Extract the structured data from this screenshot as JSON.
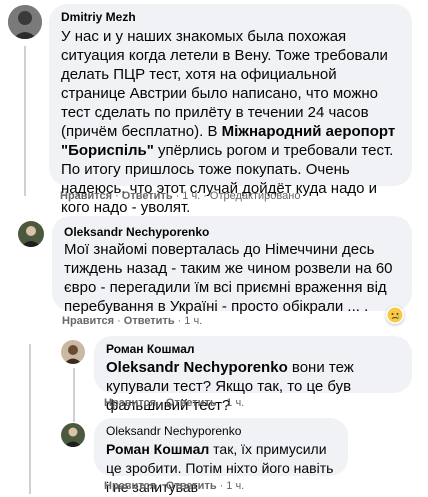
{
  "actions": {
    "like": "Нравится",
    "reply": "Ответить",
    "dot": "·"
  },
  "comments": [
    {
      "author": "Dmitriy Mezh",
      "text_parts": [
        "У нас и у наших знакомых была похожая ситуация когда летели в Вену. Тоже требовали делать ПЦР тест, хотя на официальной странице Австрии было написано, что можно тест сделать по прилёту в течении 24 часов (причём бесплатно). В ",
        "Міжнародний аеропорт \"Бориспіль\"",
        " упёрлись рогом и требовали тест. По итогу пришлось тоже покупать. Очень надеюсь, что этот случай дойдёт куда надо и кого надо - уволят."
      ],
      "time": "1 ч.",
      "edited": "Отредактировано"
    },
    {
      "author": "Oleksandr Nechyporenko",
      "text": "Мої знайомі поверталась до Німеччини десь тиждень назад - таким же чином розвели на 60 євро - перегадили їм всі приємні враження від перебування в Україні - просто обікрали ... .",
      "time": "1 ч.",
      "reaction": "sad-reaction"
    },
    {
      "author": "Роман Кошмал",
      "mention": "Oleksandr Nechyporenko",
      "text": " вони теж купували тест? Якщо так, то це був фальшивий тест?",
      "time": "1 ч."
    },
    {
      "author": "Oleksandr Nechyporenko",
      "mention": "Роман Кошмал",
      "text": " так, їх примусили це зробити. Потім ніхто його навіть і не запитував",
      "time": "1 ч."
    }
  ],
  "colors": {
    "bubble": "#f0f2f5",
    "meta": "#65676b",
    "line": "#ced0d4"
  }
}
